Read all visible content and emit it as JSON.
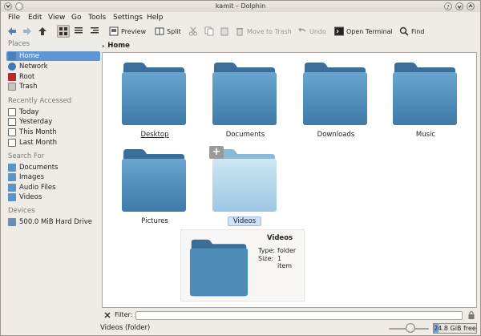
{
  "window": {
    "title": "kamit – Dolphin"
  },
  "menubar": {
    "items": [
      "File",
      "Edit",
      "View",
      "Go",
      "Tools",
      "Settings",
      "Help"
    ]
  },
  "toolbar": {
    "preview": "Preview",
    "split": "Split",
    "move_to_trash": "Move to Trash",
    "undo": "Undo",
    "open_terminal": "Open Terminal",
    "find": "Find"
  },
  "sidebar": {
    "places_title": "Places",
    "places": [
      "Home",
      "Network",
      "Root",
      "Trash"
    ],
    "recent_title": "Recently Accessed",
    "recent": [
      "Today",
      "Yesterday",
      "This Month",
      "Last Month"
    ],
    "search_title": "Search For",
    "search": [
      "Documents",
      "Images",
      "Audio Files",
      "Videos"
    ],
    "devices_title": "Devices",
    "devices": [
      "500.0 MiB Hard Drive"
    ]
  },
  "breadcrumb": {
    "current": "Home"
  },
  "folders": [
    {
      "name": "Desktop"
    },
    {
      "name": "Documents"
    },
    {
      "name": "Downloads"
    },
    {
      "name": "Music"
    },
    {
      "name": "Pictures"
    },
    {
      "name": "Videos"
    }
  ],
  "tooltip": {
    "title": "Videos",
    "type_label": "Type:",
    "type_value": "folder",
    "size_label": "Size:",
    "size_value_line1": "1",
    "size_value_line2": "item"
  },
  "filter": {
    "label": "Filter:",
    "value": ""
  },
  "statusbar": {
    "text": "Videos (folder)",
    "free_space": "24.8 GiB free",
    "free_space_used_fraction": 0.12
  },
  "colors": {
    "selection": "#5e95d2",
    "folder_dark": "#4f8cb8",
    "folder_light": "#b4d6ea"
  }
}
